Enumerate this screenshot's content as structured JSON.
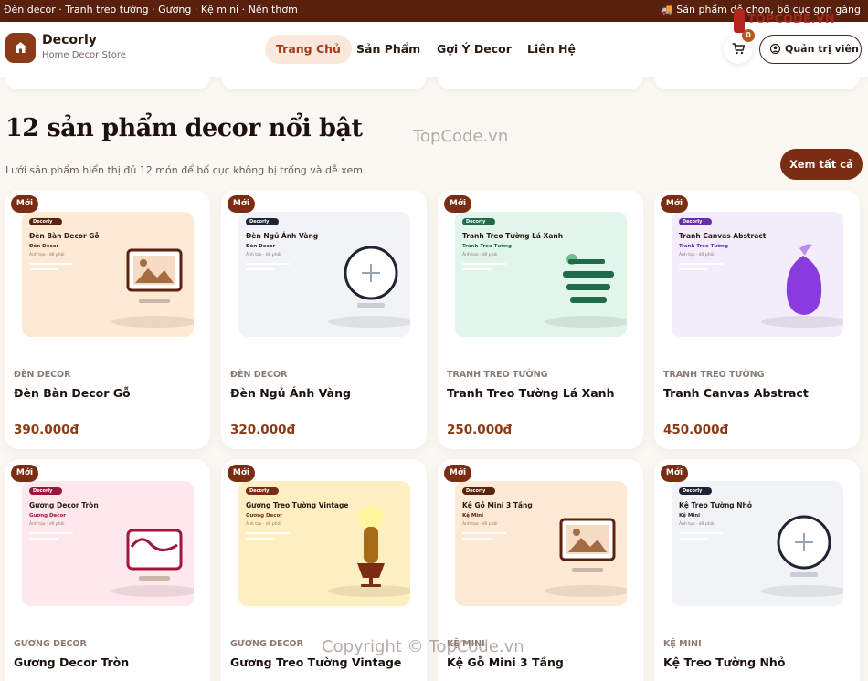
{
  "topbar": {
    "left": "Đèn decor · Tranh treo tường · Gương · Kệ mini · Nến thơm",
    "right": "Sản phẩm dễ chọn, bố cục gọn gàng"
  },
  "header": {
    "brand": "Decorly",
    "subtitle": "Home Decor Store",
    "nav": [
      "Trang Chủ",
      "Sản Phẩm",
      "Gợi Ý Decor",
      "Liên Hệ"
    ],
    "cart_count": "0",
    "admin_label": "Quản trị viên"
  },
  "section": {
    "title": "12 sản phẩm decor nổi bật",
    "subtitle": "Lưới sản phẩm hiển thị đủ 12 món để bố cục không bị trống và dễ xem.",
    "see_all": "Xem tất cả"
  },
  "watermarks": {
    "logo": "TOPCODE.VN",
    "center": "TopCode.vn",
    "copyright": "Copyright © TopCode.vn"
  },
  "products": [
    {
      "badge": "Mới",
      "brand": "Decorly",
      "title": "Đèn Bàn Decor Gỗ",
      "thumb_cat": "Đèn Decor",
      "note": "Ảnh tạo · dễ phối",
      "category": "ĐÈN DECOR",
      "name": "Đèn Bàn Decor Gỗ",
      "price": "390.000đ",
      "icon": "framed-picture-icon",
      "bg": "#fde9d4",
      "accent": "#5a2310"
    },
    {
      "badge": "Mới",
      "brand": "Decorly",
      "title": "Đèn Ngủ Ánh Vàng",
      "thumb_cat": "Đèn Decor",
      "note": "Ảnh tạo · dễ phối",
      "category": "ĐÈN DECOR",
      "name": "Đèn Ngủ Ánh Vàng",
      "price": "320.000đ",
      "icon": "round-mirror-icon",
      "bg": "#f1f3f6",
      "accent": "#1e2433"
    },
    {
      "badge": "Mới",
      "brand": "Decorly",
      "title": "Tranh Treo Tường Lá Xanh",
      "thumb_cat": "Tranh Treo Tường",
      "note": "Ảnh tạo · dễ phối",
      "category": "TRANH TREO TƯỜNG",
      "name": "Tranh Treo Tường Lá Xanh",
      "price": "250.000đ",
      "icon": "wall-shelf-icon",
      "bg": "#e2f5ea",
      "accent": "#1e6a4a"
    },
    {
      "badge": "Mới",
      "brand": "Decorly",
      "title": "Tranh Canvas Abstract",
      "thumb_cat": "Tranh Treo Tường",
      "note": "Ảnh tạo · dễ phối",
      "category": "TRANH TREO TƯỜNG",
      "name": "Tranh Canvas Abstract",
      "price": "450.000đ",
      "icon": "purple-vase-icon",
      "bg": "#f2ecfb",
      "accent": "#6a2bb0"
    },
    {
      "badge": "Mới",
      "brand": "Decorly",
      "title": "Gương Decor Tròn",
      "thumb_cat": "Gương Decor",
      "note": "Ảnh tạo · dễ phối",
      "category": "GƯƠNG DECOR",
      "name": "Gương Decor Tròn",
      "price": "",
      "icon": "wave-mirror-icon",
      "bg": "#fde8ec",
      "accent": "#a0153e"
    },
    {
      "badge": "Mới",
      "brand": "Decorly",
      "title": "Gương Treo Tường Vintage",
      "thumb_cat": "Gương Decor",
      "note": "Ảnh tạo · dễ phối",
      "category": "GƯƠNG DECOR",
      "name": "Gương Treo Tường Vintage",
      "price": "",
      "icon": "floor-lamp-icon",
      "bg": "#fdefc0",
      "accent": "#7a2d12"
    },
    {
      "badge": "Mới",
      "brand": "Decorly",
      "title": "Kệ Gỗ Mini 3 Tầng",
      "thumb_cat": "Kệ Mini",
      "note": "Ảnh tạo · dễ phối",
      "category": "KỆ MINI",
      "name": "Kệ Gỗ Mini 3 Tầng",
      "price": "",
      "icon": "framed-picture-icon",
      "bg": "#fde9d4",
      "accent": "#5a2310"
    },
    {
      "badge": "Mới",
      "brand": "Decorly",
      "title": "Kệ Treo Tường Nhỏ",
      "thumb_cat": "Kệ Mini",
      "note": "Ảnh tạo · dễ phối",
      "category": "KỆ MINI",
      "name": "Kệ Treo Tường Nhỏ",
      "price": "",
      "icon": "round-mirror-icon",
      "bg": "#f1f3f6",
      "accent": "#1e2433"
    }
  ]
}
